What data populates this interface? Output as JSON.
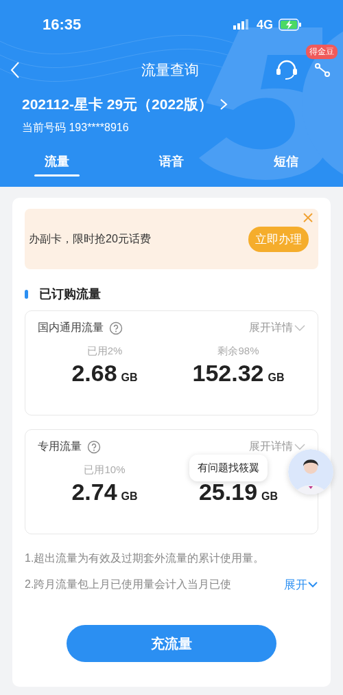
{
  "status_bar": {
    "time": "16:35",
    "network": "4G",
    "charging": true
  },
  "nav": {
    "title": "流量查询",
    "badge": "得金豆"
  },
  "plan": {
    "name": "202112-星卡 29元（2022版）",
    "number": "当前号码 193****8916"
  },
  "tabs": [
    {
      "label": "流量",
      "selected": true
    },
    {
      "label": "语音",
      "selected": false
    },
    {
      "label": "短信",
      "selected": false
    }
  ],
  "banner": {
    "text": "办副卡，限时抢20元话费",
    "button": "立即办理"
  },
  "section_title": "已订购流量",
  "usage_cards": [
    {
      "title": "国内通用流量",
      "expand": "展开详情",
      "used_label": "已用2%",
      "used_value": "2.68",
      "used_unit": "GB",
      "remain_label": "剩余98%",
      "remain_value": "152.32",
      "remain_unit": "GB"
    },
    {
      "title": "专用流量",
      "expand": "展开详情",
      "used_label": "已用10%",
      "used_value": "2.74",
      "used_unit": "GB",
      "remain_value": "25.19",
      "remain_unit": "GB"
    }
  ],
  "notes": [
    "1.超出流量为有效及过期套外流量的累计使用量。",
    "2.跨月流量包上月已使用量会计入当月已使"
  ],
  "notes_expand": "展开",
  "recharge_button": "充流量",
  "assistant": {
    "bubble": "有问题找筱翼"
  }
}
